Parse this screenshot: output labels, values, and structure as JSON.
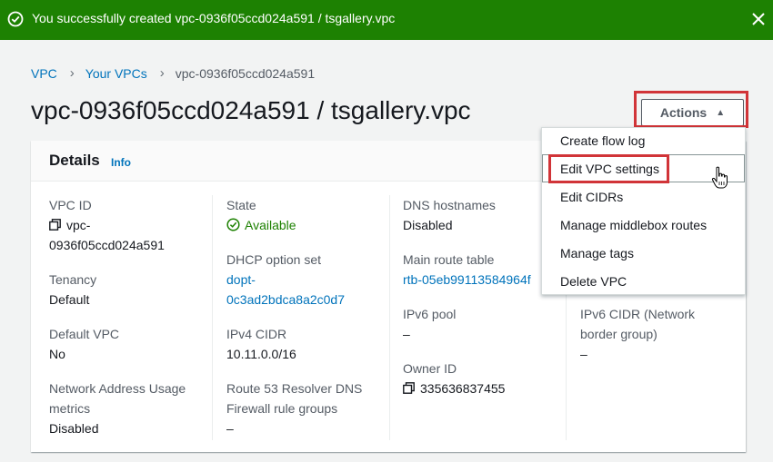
{
  "flash": {
    "message": "You successfully created vpc-0936f05ccd024a591 / tsgallery.vpc",
    "icons": {
      "status": "check-circle-icon",
      "close": "close-icon"
    },
    "color": "#1d8102"
  },
  "breadcrumb": {
    "items": [
      "VPC",
      "Your VPCs",
      "vpc-0936f05ccd024a591"
    ]
  },
  "page_title": "vpc-0936f05ccd024a591 / tsgallery.vpc",
  "actions_label": "Actions",
  "details": {
    "title": "Details",
    "info": "Info",
    "col1": {
      "vpc_id_label": "VPC ID",
      "vpc_id_line1": "vpc-",
      "vpc_id_line2": "0936f05ccd024a591",
      "tenancy_label": "Tenancy",
      "tenancy_value": "Default",
      "default_vpc_label": "Default VPC",
      "default_vpc_value": "No",
      "nau_label_line1": "Network Address Usage",
      "nau_label_line2": "metrics",
      "nau_value": "Disabled"
    },
    "col2": {
      "state_label": "State",
      "state_value": "Available",
      "dhcp_label": "DHCP option set",
      "dhcp_line1": "dopt-",
      "dhcp_line2": "0c3ad2bdca8a2c0d7",
      "ipv4_label": "IPv4 CIDR",
      "ipv4_value": "10.11.0.0/16",
      "r53_label_line1": "Route 53 Resolver DNS",
      "r53_label_line2": "Firewall rule groups",
      "r53_value": "–"
    },
    "col3": {
      "dns_label": "DNS hostnames",
      "dns_value": "Disabled",
      "route_label": "Main route table",
      "route_value": "rtb-05eb99113584964f",
      "ipv6pool_label": "IPv6 pool",
      "ipv6pool_value": "–",
      "owner_label": "Owner ID",
      "owner_value": "335636837455"
    },
    "col4": {
      "ipv6cidr_label_line1": "IPv6 CIDR (Network",
      "ipv6cidr_label_line2": "border group)",
      "ipv6cidr_value": "–"
    }
  },
  "dropdown": {
    "items": [
      "Create flow log",
      "Edit VPC settings",
      "Edit CIDRs",
      "Manage middlebox routes",
      "Manage tags",
      "Delete VPC"
    ],
    "highlight_color": "#d13438"
  }
}
